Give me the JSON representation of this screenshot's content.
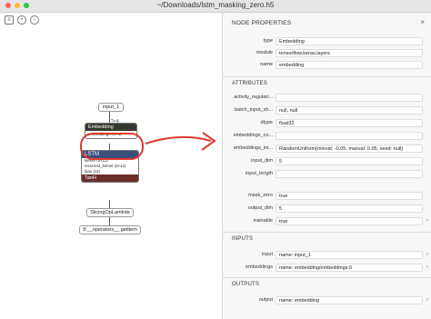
{
  "window": {
    "title": "~/Downloads/lstm_masking_zero.h5"
  },
  "colors": {
    "accent": "#e03a2e",
    "lstm": "#3b4f7c",
    "embedding": "#33392f",
    "tanh": "#6b2e2a"
  },
  "toolbar": {
    "icons": [
      "sidebar-icon",
      "zoom-in-icon",
      "zoom-out-icon"
    ]
  },
  "graph": {
    "input_node": "input_1",
    "edge_label": "?×4",
    "embedding": {
      "title": "Embedding",
      "attr": "embeddings ⟨5×5⟩"
    },
    "lstm": {
      "title": "LSTM",
      "rows": [
        "kernel ⟨5×12⟩",
        "recurrent_kernel ⟨3×12⟩",
        "bias ⟨12⟩"
      ],
      "activation": "TanH"
    },
    "slicing_node": "SlicingOpLambda",
    "getitem_node": "tf.__operators__.getitem"
  },
  "panel": {
    "title": "NODE PROPERTIES",
    "close": "×",
    "node": [
      {
        "label": "type",
        "value": "Embedding"
      },
      {
        "label": "module",
        "value": "tensorflow.keras.layers"
      },
      {
        "label": "name",
        "value": "embedding"
      }
    ],
    "attributes_title": "ATTRIBUTES",
    "attributes": [
      {
        "label": "activity_regulari...",
        "value": ""
      },
      {
        "label": "batch_input_sh...",
        "value": "null, null"
      },
      {
        "label": "dtype",
        "value": "float32"
      },
      {
        "label": "embeddings_co...",
        "value": ""
      },
      {
        "label": "embeddings_ini...",
        "value": "RandomUniform{minval: -0.05, maxval: 0.05, seed: null}"
      },
      {
        "label": "input_dim",
        "value": "5"
      },
      {
        "label": "input_length",
        "value": ""
      },
      {
        "label": "mask_zero",
        "value": "true"
      },
      {
        "label": "output_dim",
        "value": "5"
      },
      {
        "label": "trainable",
        "value": "true"
      }
    ],
    "inputs_title": "INPUTS",
    "inputs": [
      {
        "label": "input",
        "value": "name: input_1"
      },
      {
        "label": "embeddings",
        "value": "name: embedding/embeddings:0"
      }
    ],
    "outputs_title": "OUTPUTS",
    "outputs": [
      {
        "label": "output",
        "value": "name: embedding"
      }
    ]
  }
}
